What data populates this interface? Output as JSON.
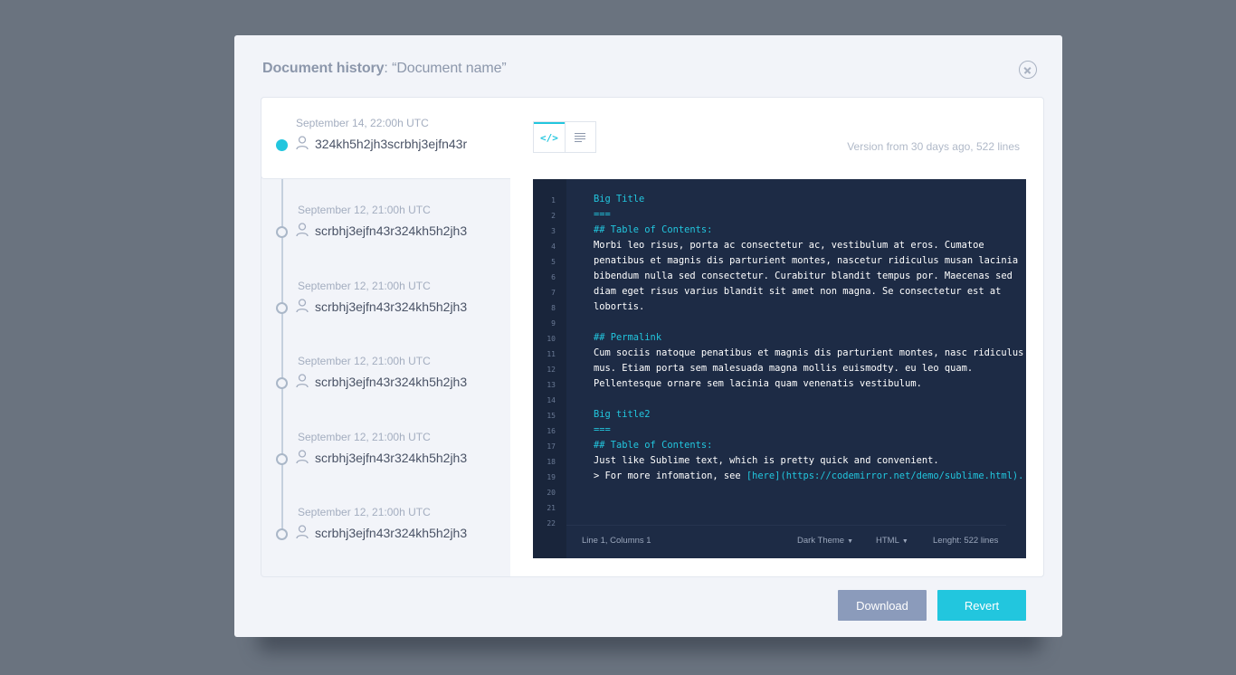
{
  "dialog": {
    "title_bold": "Document history",
    "title_rest": ": “Document name”"
  },
  "history": [
    {
      "date": "September 14, 22:00h UTC",
      "hash": "324kh5h2jh3scrbhj3ejfn43r",
      "active": true
    },
    {
      "date": "September 12, 21:00h UTC",
      "hash": "scrbhj3ejfn43r324kh5h2jh3",
      "active": false
    },
    {
      "date": "September 12, 21:00h UTC",
      "hash": "scrbhj3ejfn43r324kh5h2jh3",
      "active": false
    },
    {
      "date": "September 12, 21:00h UTC",
      "hash": "scrbhj3ejfn43r324kh5h2jh3",
      "active": false
    },
    {
      "date": "September 12, 21:00h UTC",
      "hash": "scrbhj3ejfn43r324kh5h2jh3",
      "active": false
    },
    {
      "date": "September 12, 21:00h UTC",
      "hash": "scrbhj3ejfn43r324kh5h2jh3",
      "active": false
    }
  ],
  "viewer": {
    "toggle": {
      "code_label": "</>",
      "text_icon": "text-lines-icon"
    },
    "version_info": "Version from 30 days ago, 522 lines"
  },
  "editor": {
    "lines": [
      {
        "n": "1",
        "text": "Big Title",
        "cyan": true
      },
      {
        "n": "2",
        "text": "===",
        "cyan": true
      },
      {
        "n": "3",
        "text": "## Table of Contents:",
        "cyan": true
      },
      {
        "n": "4",
        "text": "Morbi leo risus, porta ac consectetur ac, vestibulum at eros. Cumatoe",
        "cyan": false
      },
      {
        "n": "5",
        "text": "penatibus et magnis dis parturient montes, nascetur ridiculus musan lacinia",
        "cyan": false
      },
      {
        "n": "6",
        "text": "bibendum nulla sed consectetur. Curabitur blandit tempus por. Maecenas sed",
        "cyan": false
      },
      {
        "n": "7",
        "text": "diam eget risus varius blandit sit amet non magna. Se consectetur est at",
        "cyan": false
      },
      {
        "n": "8",
        "text": "lobortis.",
        "cyan": false
      },
      {
        "n": "9",
        "text": "",
        "cyan": false
      },
      {
        "n": "10",
        "text": "## Permalink",
        "cyan": true
      },
      {
        "n": "11",
        "text": "Cum sociis natoque penatibus et magnis dis parturient montes, nasc ridiculus",
        "cyan": false
      },
      {
        "n": "12",
        "text": "mus. Etiam porta sem malesuada magna mollis euismodty. eu leo quam.",
        "cyan": false
      },
      {
        "n": "13",
        "text": "Pellentesque ornare sem lacinia quam venenatis vestibulum.",
        "cyan": false
      },
      {
        "n": "14",
        "text": "",
        "cyan": false
      },
      {
        "n": "15",
        "text": "Big title2",
        "cyan": true
      },
      {
        "n": "16",
        "text": "===",
        "cyan": true
      },
      {
        "n": "17",
        "text": "## Table of Contents:",
        "cyan": true
      },
      {
        "n": "18",
        "text": "Just like Sublime text, which is pretty quick and convenient.",
        "cyan": false
      },
      {
        "n": "19",
        "text": "> For more infomation, see ",
        "link": "[here](https://codemirror.net/demo/sublime.html).",
        "cyan": false
      },
      {
        "n": "20",
        "text": "",
        "cyan": false
      },
      {
        "n": "21",
        "text": "",
        "cyan": false
      },
      {
        "n": "22",
        "text": "",
        "cyan": false
      }
    ],
    "status": {
      "position": "Line 1, Columns 1",
      "theme": "Dark Theme",
      "language": "HTML",
      "length_label": "Lenght:",
      "length_value": "522 lines"
    }
  },
  "actions": {
    "download": "Download",
    "revert": "Revert"
  },
  "colors": {
    "accent": "#22c6de",
    "editor_bg": "#1d2b45",
    "secondary_button": "#8b9bbb"
  }
}
